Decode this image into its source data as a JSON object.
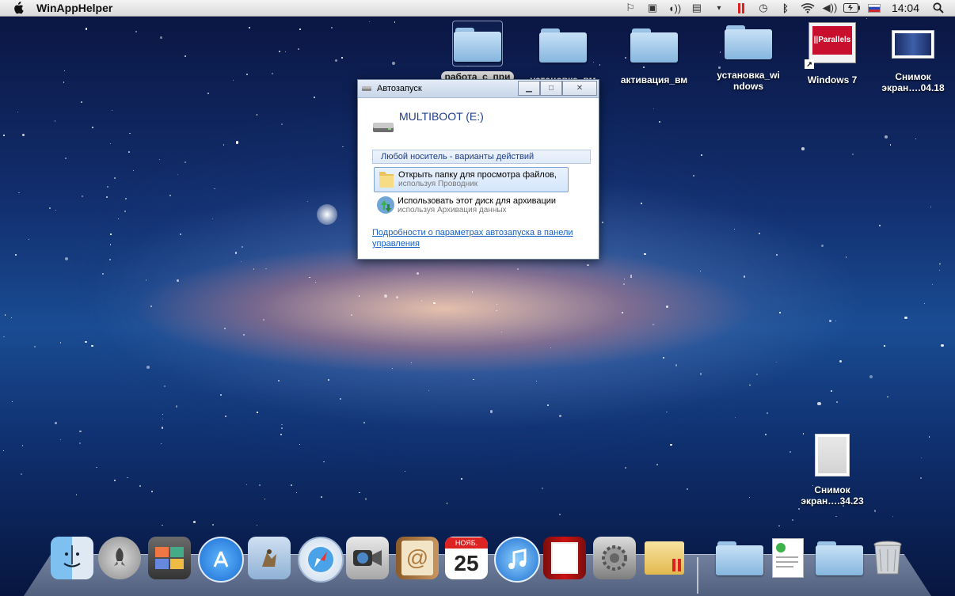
{
  "menubar": {
    "app_name": "WinAppHelper",
    "clock": "14:04",
    "icons": [
      "flag-icon",
      "sync-icon",
      "speaker-icon",
      "clipboard-icon",
      "dropdown-icon",
      "parallels-icon",
      "time-machine-icon",
      "bluetooth-icon",
      "wifi-icon",
      "volume-icon",
      "battery-icon",
      "flag-ru-icon"
    ]
  },
  "desktop": {
    "icons": [
      {
        "name": "folder",
        "label": "работа_с_при"
      },
      {
        "name": "folder",
        "label": "установка_вм"
      },
      {
        "name": "folder",
        "label": "активация_вм"
      },
      {
        "name": "folder",
        "label": "установка_wi\nndows"
      },
      {
        "name": "parallels",
        "label": "Windows 7",
        "badge": "||Parallels"
      },
      {
        "name": "screenshot",
        "label": "Снимок\nэкран….04.18"
      },
      {
        "name": "screenshot-blank",
        "label": "Снимок\nэкран….34.23"
      }
    ]
  },
  "autoplay_window": {
    "title": "Автозапуск",
    "drive_label": "MULTIBOOT (E:)",
    "section_header": "Любой носитель - варианты действий",
    "options": [
      {
        "line1": "Открыть папку для просмотра файлов,",
        "line2": "используя Проводник"
      },
      {
        "line1": "Использовать этот диск для архивации",
        "line2": "используя Архивация данных"
      }
    ],
    "link": "Подробности о параметрах автозапуска в панели управления"
  },
  "dock": {
    "items": [
      "finder",
      "launchpad",
      "photo-booth",
      "app-store",
      "preview",
      "safari",
      "facetime",
      "address-book",
      "calendar",
      "itunes",
      "photo-booth-2",
      "system-preferences",
      "parallels-folder",
      "scanner-folder",
      "document-file",
      "windows-folder",
      "trash"
    ],
    "calendar_month": "НОЯБ.",
    "calendar_day": "25"
  },
  "colors": {
    "link": "#1960c6",
    "window_title": "#1f3d8a"
  }
}
